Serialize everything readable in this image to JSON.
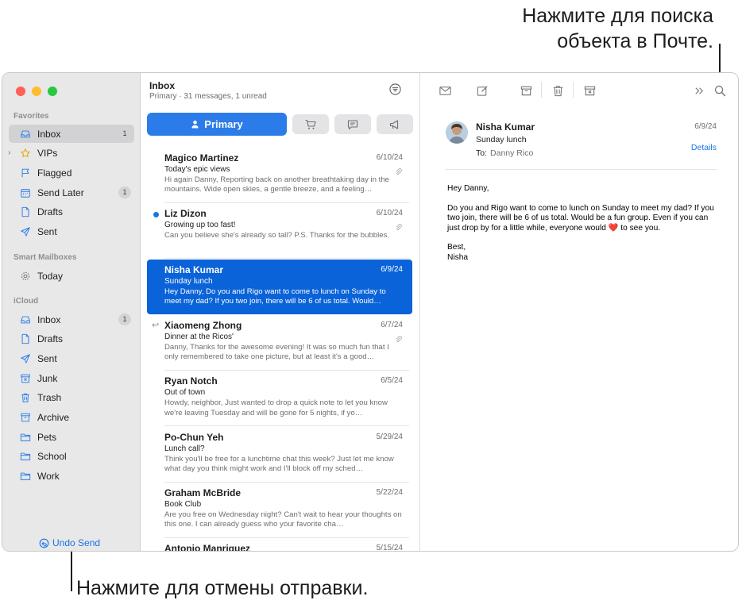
{
  "callouts": {
    "search": "Нажмите для поиска\nобъекта в Почте.",
    "undo": "Нажмите для отмены отправки."
  },
  "sidebar": {
    "favorites_title": "Favorites",
    "smart_title": "Smart Mailboxes",
    "icloud_title": "iCloud",
    "favorites": [
      {
        "label": "Inbox",
        "icon": "inbox-icon",
        "badge": "1",
        "selected": true
      },
      {
        "label": "VIPs",
        "icon": "star-icon",
        "badge": ""
      },
      {
        "label": "Flagged",
        "icon": "flag-icon",
        "badge": ""
      },
      {
        "label": "Send Later",
        "icon": "calendar-icon",
        "badge": "1"
      },
      {
        "label": "Drafts",
        "icon": "document-icon",
        "badge": ""
      },
      {
        "label": "Sent",
        "icon": "paperplane-icon",
        "badge": ""
      }
    ],
    "smart": [
      {
        "label": "Today",
        "icon": "gear-icon",
        "badge": ""
      }
    ],
    "icloud": [
      {
        "label": "Inbox",
        "icon": "inbox-icon",
        "badge": "1"
      },
      {
        "label": "Drafts",
        "icon": "document-icon",
        "badge": ""
      },
      {
        "label": "Sent",
        "icon": "paperplane-icon",
        "badge": ""
      },
      {
        "label": "Junk",
        "icon": "junk-icon",
        "badge": ""
      },
      {
        "label": "Trash",
        "icon": "trash-icon",
        "badge": ""
      },
      {
        "label": "Archive",
        "icon": "archive-icon",
        "badge": ""
      },
      {
        "label": "Pets",
        "icon": "folder-icon",
        "badge": ""
      },
      {
        "label": "School",
        "icon": "folder-icon",
        "badge": ""
      },
      {
        "label": "Work",
        "icon": "folder-icon",
        "badge": ""
      }
    ],
    "undo_send": "Undo Send"
  },
  "list": {
    "title": "Inbox",
    "subtitle": "Primary · 31 messages, 1 unread",
    "tab_primary": "Primary",
    "messages": [
      {
        "from": "Magico Martinez",
        "date": "6/10/24",
        "subject": "Today's epic views",
        "preview": "Hi again Danny, Reporting back on another breathtaking day in the mountains. Wide open skies, a gentle breeze, and a feeling…",
        "attachment": true
      },
      {
        "from": "Liz Dizon",
        "date": "6/10/24",
        "subject": "Growing up too fast!",
        "preview": "Can you believe she's already so tall? P.S. Thanks for the bubbles.",
        "attachment": true,
        "unread": true
      },
      {
        "from": "Nisha Kumar",
        "date": "6/9/24",
        "subject": "Sunday lunch",
        "preview": "Hey Danny, Do you and Rigo want to come to lunch on Sunday to meet my dad? If you two join, there will be 6 of us total. Would…",
        "selected": true
      },
      {
        "from": "Xiaomeng Zhong",
        "date": "6/7/24",
        "subject": "Dinner at the Ricos'",
        "preview": "Danny, Thanks for the awesome evening! It was so much fun that I only remembered to take one picture, but at least it's a good…",
        "attachment": true,
        "replied": true
      },
      {
        "from": "Ryan Notch",
        "date": "6/5/24",
        "subject": "Out of town",
        "preview": "Howdy, neighbor, Just wanted to drop a quick note to let you know we're leaving Tuesday and will be gone for 5 nights, if yo…"
      },
      {
        "from": "Po-Chun Yeh",
        "date": "5/29/24",
        "subject": "Lunch call?",
        "preview": "Think you'll be free for a lunchtime chat this week? Just let me know what day you think might work and I'll block off my sched…"
      },
      {
        "from": "Graham McBride",
        "date": "5/22/24",
        "subject": "Book Club",
        "preview": "Are you free on Wednesday night? Can't wait to hear your thoughts on this one. I can already guess who your favorite cha…"
      },
      {
        "from": "Antonio Manriquez",
        "date": "5/15/24",
        "subject": "",
        "preview": ""
      }
    ]
  },
  "reader": {
    "from": "Nisha Kumar",
    "subject": "Sunday lunch",
    "to_label": "To:",
    "to_value": "Danny Rico",
    "date": "6/9/24",
    "details": "Details",
    "greeting": "Hey Danny,",
    "body_before_heart": "Do you and Rigo want to come to lunch on Sunday to meet my dad? If you two join, there will be 6 of us total. Would be a fun group. Even if you can just drop by for a little while, everyone would",
    "heart": "❤️",
    "body_after_heart": " to see you.",
    "signoff": "Best,\nNisha"
  },
  "colors": {
    "accent": "#2b7ce9",
    "selection": "#0a63d8",
    "sidebar_bg": "#e8e8e8",
    "traffic_red": "#fe5f57",
    "traffic_yellow": "#febc2e",
    "traffic_green": "#28c840"
  }
}
